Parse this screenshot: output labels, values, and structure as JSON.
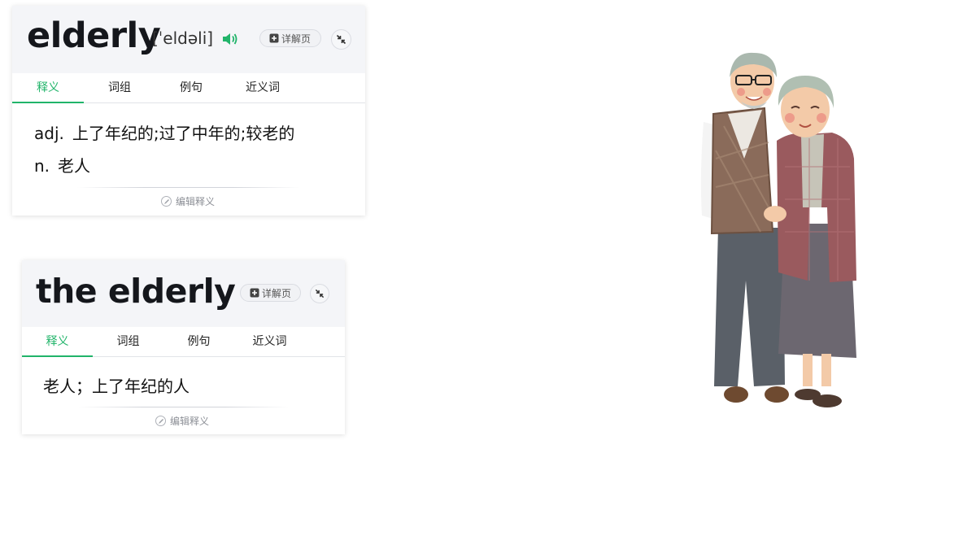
{
  "card1": {
    "word": "elderly",
    "phonetic": "[ˈeldəli]",
    "detail_label": "详解页",
    "tabs": [
      "释义",
      "词组",
      "例句",
      "近义词"
    ],
    "definitions": [
      {
        "pos": "adj.",
        "text": "上了年纪的;过了中年的;较老的"
      },
      {
        "pos": "n.",
        "text": "老人"
      }
    ],
    "edit_label": "编辑释义"
  },
  "card2": {
    "word": "the elderly",
    "detail_label": "详解页",
    "tabs": [
      "释义",
      "词组",
      "例句",
      "近义词"
    ],
    "definitions": [
      {
        "pos": "",
        "text": "老人；上了年纪的人"
      }
    ],
    "edit_label": "编辑释义"
  },
  "icons": {
    "speaker": "speaker-icon",
    "detail": "document-plus-icon",
    "collapse": "collapse-arrows-icon",
    "edit": "pencil-icon"
  },
  "colors": {
    "accent": "#21b46a",
    "header_bg": "#f4f5f8",
    "word": "#15171c"
  },
  "illustration": "elderly couple embracing cartoon"
}
